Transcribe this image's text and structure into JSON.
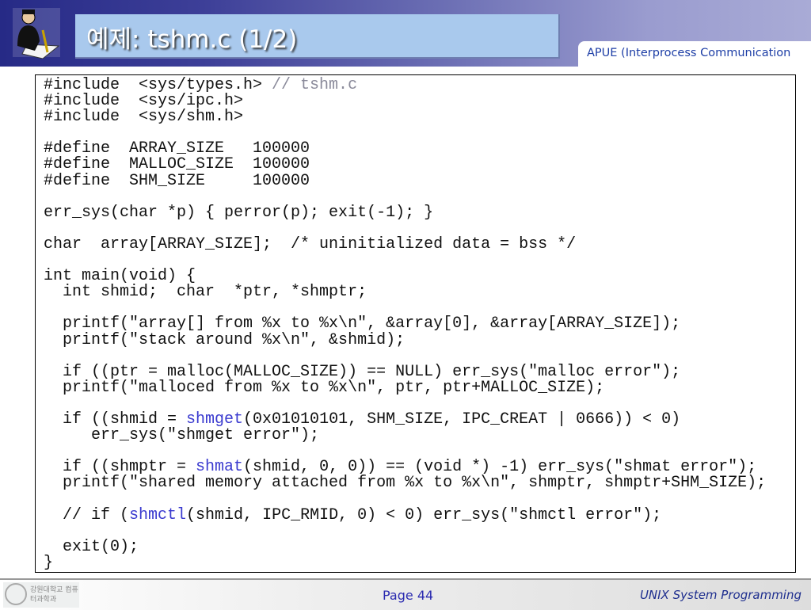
{
  "header": {
    "title": "예제: tshm.c (1/2)",
    "subtitle": "APUE (Interprocess Communication"
  },
  "code": {
    "lines": [
      [
        {
          "t": "#include  <sys/types.h> "
        },
        {
          "t": "// tshm.c",
          "c": "cm"
        }
      ],
      [
        {
          "t": "#include  <sys/ipc.h>"
        }
      ],
      [
        {
          "t": "#include  <sys/shm.h>"
        }
      ],
      [],
      [
        {
          "t": "#define  ARRAY_SIZE   100000"
        }
      ],
      [
        {
          "t": "#define  MALLOC_SIZE  100000"
        }
      ],
      [
        {
          "t": "#define  SHM_SIZE     100000"
        }
      ],
      [],
      [
        {
          "t": "err_sys(char *p) { perror(p); exit(-1); }"
        }
      ],
      [],
      [
        {
          "t": "char  array[ARRAY_SIZE];  /* uninitialized data = bss */"
        }
      ],
      [],
      [
        {
          "t": "int main(void) {"
        }
      ],
      [
        {
          "t": "  int shmid;  char  *ptr, *shmptr;"
        }
      ],
      [],
      [
        {
          "t": "  printf(\"array[] from %x to %x\\n\", &array[0], &array[ARRAY_SIZE]);"
        }
      ],
      [
        {
          "t": "  printf(\"stack around %x\\n\", &shmid);"
        }
      ],
      [],
      [
        {
          "t": "  if ((ptr = malloc(MALLOC_SIZE)) == NULL) err_sys(\"malloc error\");"
        }
      ],
      [
        {
          "t": "  printf(\"malloced from %x to %x\\n\", ptr, ptr+MALLOC_SIZE);"
        }
      ],
      [],
      [
        {
          "t": "  if ((shmid = "
        },
        {
          "t": "shmget",
          "c": "kw"
        },
        {
          "t": "(0x01010101, SHM_SIZE, IPC_CREAT | 0666)) < 0)"
        }
      ],
      [
        {
          "t": "     err_sys(\"shmget error\");"
        }
      ],
      [],
      [
        {
          "t": "  if ((shmptr = "
        },
        {
          "t": "shmat",
          "c": "kw"
        },
        {
          "t": "(shmid, 0, 0)) == (void *) -1) err_sys(\"shmat error\");"
        }
      ],
      [
        {
          "t": "  printf(\"shared memory attached from %x to %x\\n\", shmptr, shmptr+SHM_SIZE);"
        }
      ],
      [],
      [
        {
          "t": "  // if ("
        },
        {
          "t": "shmctl",
          "c": "kw"
        },
        {
          "t": "(shmid, IPC_RMID, 0) < 0) err_sys(\"shmctl error\");"
        }
      ],
      [],
      [
        {
          "t": "  exit(0);"
        }
      ],
      [
        {
          "t": "}"
        }
      ]
    ]
  },
  "footer": {
    "logo_text": "강원대학교 컴퓨터과학과",
    "page": "Page 44",
    "course": "UNIX System Programming"
  },
  "colors": {
    "accent": "#1d3ea6",
    "keyword": "#3a3acf",
    "comment": "#8a8a9a"
  }
}
